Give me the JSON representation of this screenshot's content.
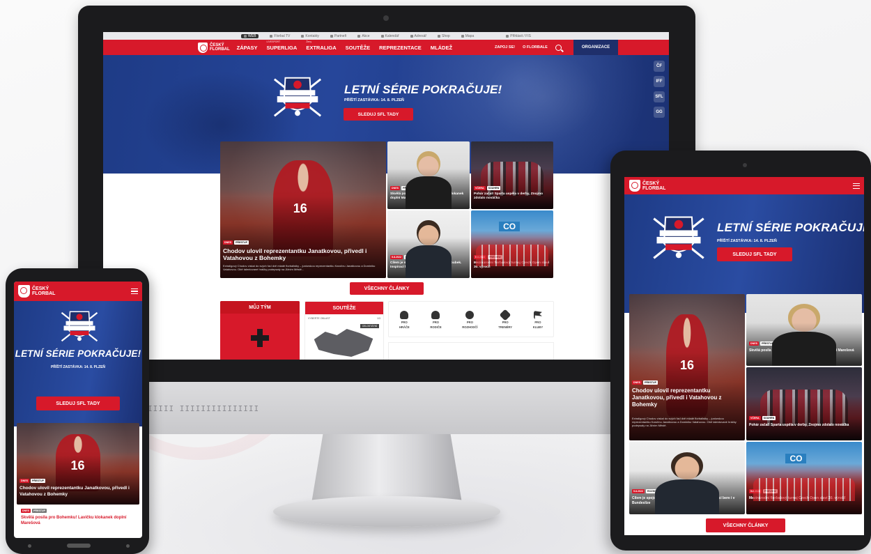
{
  "brand": {
    "name_line1": "ČESKÝ",
    "name_line2": "FLORBAL",
    "accent_color": "#d7192a",
    "navy_color": "#1f2f6b"
  },
  "desktop": {
    "utility_bar": {
      "items": [
        "WEB",
        "Florbal TV",
        "Kontakty",
        "Partneři",
        "Akce",
        "Kalendář",
        "Adresář",
        "Shop",
        "Mapa"
      ],
      "login": "Přihlásit / FIS"
    },
    "nav": {
      "items": [
        {
          "label": "ZÁPASY",
          "tiny": ""
        },
        {
          "label": "SUPERLIGA",
          "tiny": "LIVESPORT"
        },
        {
          "label": "EXTRALIGA",
          "tiny": "Ženy"
        },
        {
          "label": "SOUTĚŽE",
          "tiny": ""
        },
        {
          "label": "REPREZENTACE",
          "tiny": ""
        },
        {
          "label": "MLÁDEŽ",
          "tiny": ""
        }
      ],
      "right_items": [
        "ZAPOJ SE!",
        "O FLORBALE"
      ],
      "org_button": "ORGANIZACE"
    },
    "side_icons": [
      "ČF",
      "IFF",
      "SFL",
      "GG"
    ],
    "hero": {
      "title": "LETNÍ SÉRIE POKRAČUJE!",
      "subtitle": "PŘÍŠTÍ ZASTÁVKA: 14. 8. PLZEŇ",
      "button": "SLEDUJ SFL TADY"
    },
    "articles": [
      {
        "tags": [
          "DNES",
          "PŘESTUP"
        ],
        "title": "Chodov ulovil reprezentantku Janatkovou, přivedl i Vatahovou z Bohemky",
        "perex": "Extraligový Chodov získal do svých řad dvě mladé florbalistky – juniorskou reprezentantku Karolínu Janatkovou a Dominiku Vatahovou. Obě talentované hráčky podepsaly na Jižním Městě..."
      },
      {
        "tags": [
          "DNES",
          "PŘESTUP"
        ],
        "title": "Skvělá posila pro Bohemku! Lavičku klokanek doplní Marešová",
        "perex": ""
      },
      {
        "tags": [
          "VČERA",
          "SOUHRN"
        ],
        "title": "Pohár začal! Sparta uspěla v derby, Znojmo zdolalo nováčka",
        "perex": ""
      },
      {
        "tags": [
          "5.8.2022",
          "ROZHOVOR"
        ],
        "title": "Cílem je spojovat a vzdělávat, říká Jakoubek. Inspirací bere i v Bundeslize",
        "perex": ""
      },
      {
        "tags": [
          "5.8.2022",
          "PREVIEW"
        ],
        "title": "Mezinárodní florbalový turnaj Czech Open slaví 30. výročí!",
        "perex": ""
      }
    ],
    "all_articles_button": "VŠECHNY ČLÁNKY",
    "widgets": {
      "my_team": "MŮJ TÝM",
      "competitions": "SOUTĚŽE",
      "region_label": "VYBERTE OBLAST",
      "region_count": "1/3",
      "selected": "CELOSTÁTNÍ"
    },
    "roles": [
      {
        "line1": "PRO",
        "line2": "HRÁČE",
        "icon": "player-icon"
      },
      {
        "line1": "PRO",
        "line2": "RODIČE",
        "icon": "parents-icon"
      },
      {
        "line1": "PRO",
        "line2": "ROZHODČÍ",
        "icon": "whistle-icon"
      },
      {
        "line1": "PRO",
        "line2": "TRENÉRY",
        "icon": "clipboard-icon"
      },
      {
        "line1": "PRO",
        "line2": "KLUBY",
        "icon": "flag-icon"
      }
    ],
    "social": [
      {
        "icon": "facebook-icon",
        "color": "#1877f2"
      },
      {
        "icon": "instagram-icon",
        "color": "#c13584"
      },
      {
        "icon": "youtube-icon",
        "color": "#ff0000"
      },
      {
        "icon": "twitter-icon",
        "color": "#1da1f2"
      },
      {
        "icon": "mobile-icon",
        "color": "#333333"
      }
    ],
    "chin_slots": "IIIII IIIIIIIIIIIIIII"
  },
  "tablet": {
    "articles": [
      {
        "tags": [
          "DNES",
          "PŘESTUP"
        ],
        "title": "Chodov ulovil reprezentantku Janatkovou, přivedl i Vatahovou z Bohemky",
        "perex": "Extraligový Chodov získal do svých řad dvě mladé florbalistky – juniorskou reprezentantku Karolínu Janatkovou a Dominiku Vatahovou. Obě talentované hráčky podepsaly na Jižním Městě."
      },
      {
        "tags": [
          "DNES",
          "PŘESTUP"
        ],
        "title": "Skvělá posila pro Bohemku! Lavičku klokanek doplní Marešová"
      },
      {
        "tags": [
          "VČERA",
          "SOUHRN"
        ],
        "title": "Pohár začal! Sparta uspěla v derby, Znojmo zdolalo nováčka"
      },
      {
        "tags": [
          "5.8.2022",
          "ROZHOVOR"
        ],
        "title": "Cílem je spojovat a vzdělávat, říká Jakoubek. Inspirací bere i v Bundeslize"
      },
      {
        "tags": [
          "5.8.2022",
          "PREVIEW"
        ],
        "title": "Mezinárodní florbalový turnaj Czech Open slaví 30. výročí!"
      }
    ]
  },
  "phone": {
    "hero_title": "LETNÍ SÉRIE POKRAČUJE!",
    "hero_subtitle": "PŘÍŠTÍ ZASTÁVKA: 14. 8. PLZEŇ",
    "hero_button": "SLEDUJ SFL TADY",
    "article_tags": [
      "DNES",
      "PŘESTUP"
    ],
    "article_title": "Chodov ulovil reprezentantku Janatkovou, přivedl i Vatahovou z Bohemky",
    "sub_tags": [
      "DNES",
      "PŘESTUP"
    ],
    "sub_title": "Skvělá posila pro Bohemku! Lavičku klokanek doplní Marešová"
  }
}
